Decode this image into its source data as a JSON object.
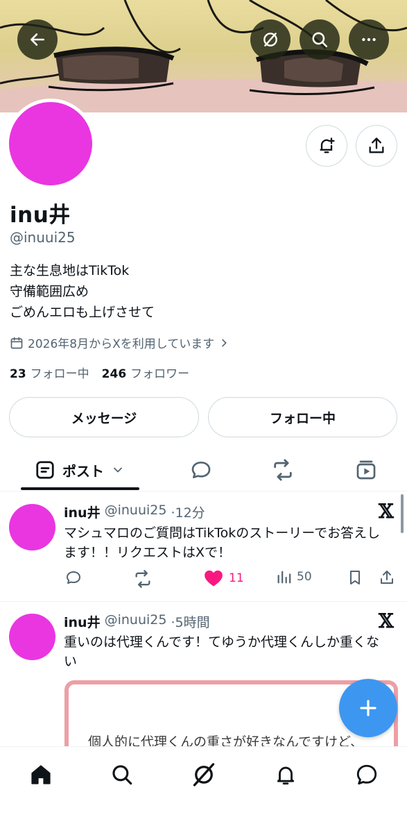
{
  "profile": {
    "display_name": "inu井",
    "handle": "@inuui25",
    "bio": [
      "主な生息地はTikTok",
      "守備範囲広め",
      "ごめんエロも上げさせて"
    ],
    "joined": "2026年8月からXを利用しています",
    "following_count": "23",
    "following_label": "フォロー中",
    "followers_count": "246",
    "followers_label": "フォロワー",
    "avatar_color": "#e936e1"
  },
  "actions": {
    "message_label": "メッセージ",
    "following_button_label": "フォロー中"
  },
  "tabs": {
    "active_label": "ポスト"
  },
  "posts": [
    {
      "name": "inu井",
      "handle": "@inuui25",
      "time": "·12分",
      "text": "マシュマロのご質問はTikTokのストーリーでお答えします！！リクエストはXで！",
      "likes": "11",
      "views": "50",
      "liked": true
    },
    {
      "name": "inu井",
      "handle": "@inuui25",
      "time": "·5時間",
      "text": "重いのは代理くんです！てゆうか代理くんしか重くない",
      "media_text": "個人的に代理くんの重さが好きなんですけど、"
    }
  ],
  "x_logo": "𝕏",
  "colors": {
    "accent": "#3d97f0",
    "like": "#f91880",
    "muted": "#536471",
    "avatar": "#e936e1"
  },
  "icons": {
    "top_bar": [
      "back-arrow-icon",
      "grok-icon",
      "search-icon",
      "more-icon"
    ],
    "profile": [
      "notification-add-icon",
      "share-icon"
    ],
    "tabs": [
      "posts-icon",
      "chevron-down-icon",
      "reply-icon",
      "repost-icon",
      "media-icon"
    ],
    "post_actions": [
      "reply-icon",
      "repost-icon",
      "like-icon",
      "views-icon",
      "bookmark-icon",
      "share-icon"
    ],
    "bottom_nav": [
      "home-icon",
      "search-icon",
      "grok-icon",
      "notifications-icon",
      "messages-icon"
    ]
  }
}
